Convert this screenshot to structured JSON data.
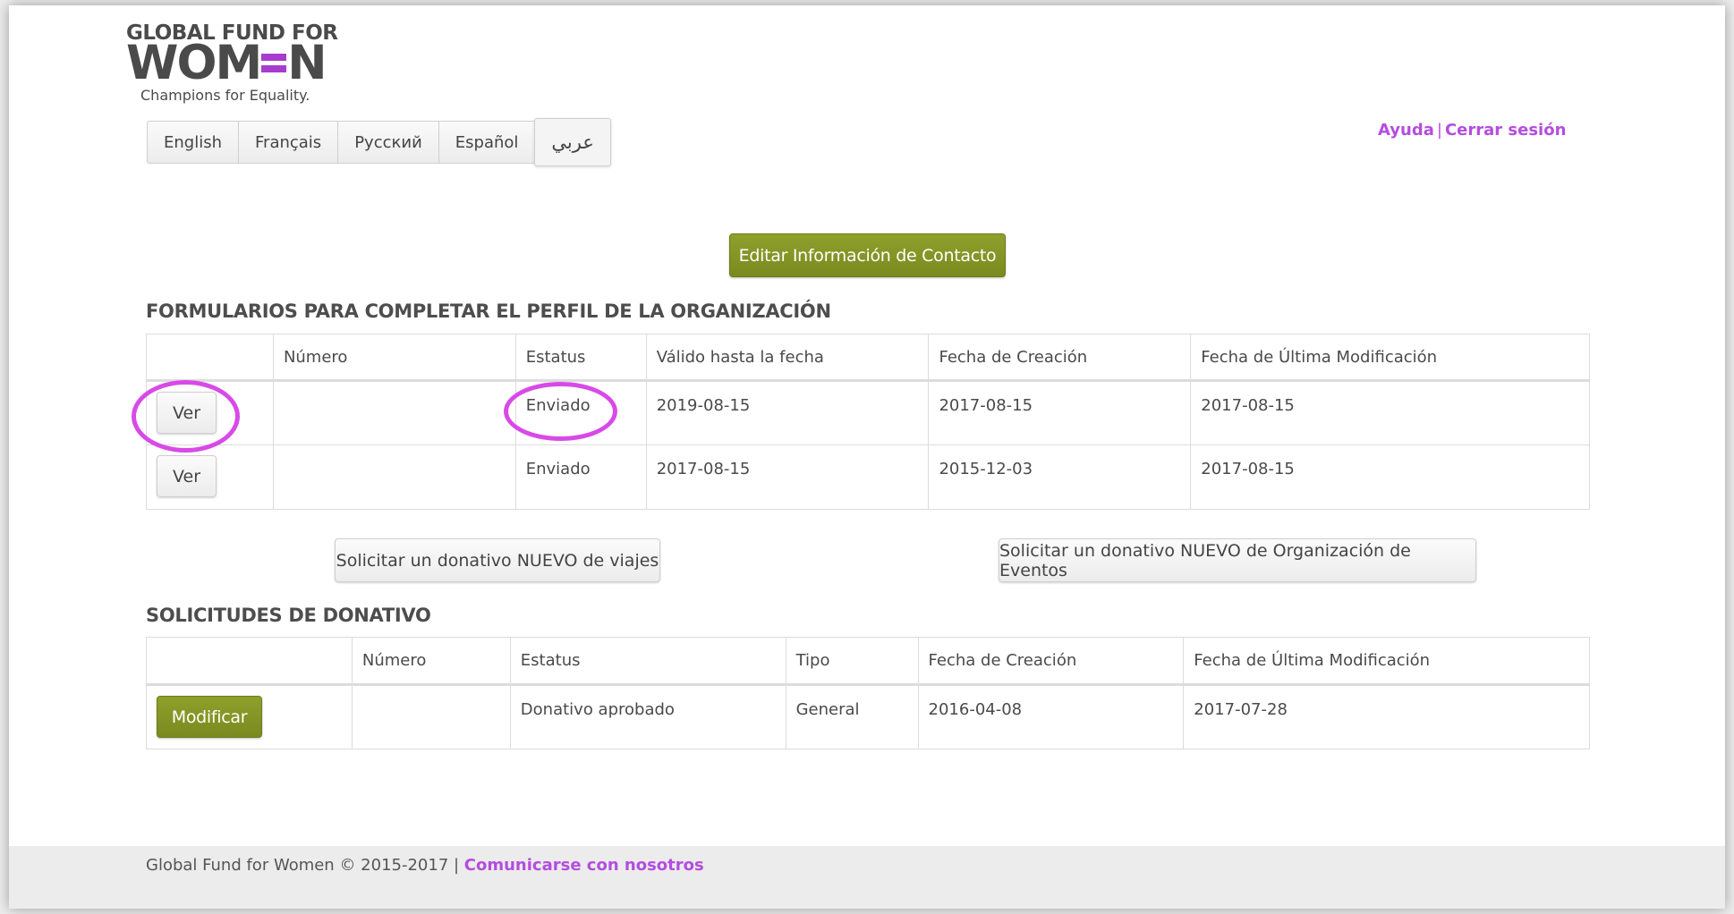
{
  "logo": {
    "line1": "GLOBAL FUND FOR",
    "line2_left": "WOM",
    "line2_right": "N",
    "tagline": "Champions for Equality."
  },
  "languages": [
    "English",
    "Français",
    "Русский",
    "Español",
    "عربي"
  ],
  "toplinks": {
    "help": "Ayuda",
    "separator": "|",
    "logout": "Cerrar sesión"
  },
  "edit_contact_label": "Editar Información de Contacto",
  "profile_forms": {
    "title": "FORMULARIOS PARA COMPLETAR EL PERFIL DE LA ORGANIZACIÓN",
    "headers": [
      "",
      "Número",
      "Estatus",
      "Válido hasta la fecha",
      "Fecha de Creación",
      "Fecha de Última Modificación"
    ],
    "rows": [
      {
        "action": "Ver",
        "numero": "",
        "estatus": "Enviado",
        "valido": "2019-08-15",
        "creacion": "2017-08-15",
        "modificacion": "2017-08-15"
      },
      {
        "action": "Ver",
        "numero": "",
        "estatus": "Enviado",
        "valido": "2017-08-15",
        "creacion": "2015-12-03",
        "modificacion": "2017-08-15"
      }
    ]
  },
  "request_travel_label": "Solicitar un donativo NUEVO de viajes",
  "request_events_label": "Solicitar un donativo NUEVO de Organización de Eventos",
  "grant_requests": {
    "title": "SOLICITUDES DE DONATIVO",
    "headers": [
      "",
      "Número",
      "Estatus",
      "Tipo",
      "Fecha de Creación",
      "Fecha de Última Modificación"
    ],
    "rows": [
      {
        "action": "Modificar",
        "numero": "",
        "estatus": "Donativo aprobado",
        "tipo": "General",
        "creacion": "2016-04-08",
        "modificacion": "2017-07-28"
      }
    ]
  },
  "footer": {
    "text": "Global Fund for Women © 2015-2017 | ",
    "contact": "Comunicarse con nosotros"
  },
  "colors": {
    "accent": "#b44de0",
    "olive": "#7f8f22",
    "highlight_circle": "#d84ae8"
  }
}
